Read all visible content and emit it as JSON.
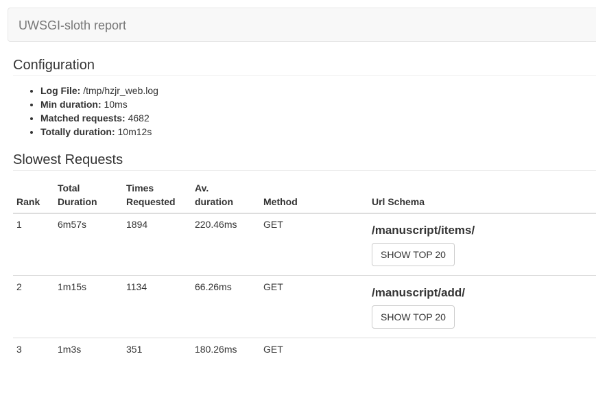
{
  "navbar": {
    "brand": "UWSGI-sloth report"
  },
  "configuration": {
    "heading": "Configuration",
    "items": [
      {
        "label": "Log File:",
        "value": "/tmp/hzjr_web.log"
      },
      {
        "label": "Min duration:",
        "value": "10ms"
      },
      {
        "label": "Matched requests:",
        "value": "4682"
      },
      {
        "label": "Totally duration:",
        "value": "10m12s"
      }
    ]
  },
  "slowest": {
    "heading": "Slowest Requests",
    "columns": {
      "rank": "Rank",
      "total_l1": "Total",
      "total_l2": "Duration",
      "times_l1": "Times",
      "times_l2": "Requested",
      "avg_l1": "Av.",
      "avg_l2": "duration",
      "method": "Method",
      "url": "Url Schema"
    },
    "rows": [
      {
        "rank": "1",
        "total": "6m57s",
        "times": "1894",
        "avg": "220.46ms",
        "method": "GET",
        "url": "/manuscript/items/",
        "button": "SHOW TOP 20"
      },
      {
        "rank": "2",
        "total": "1m15s",
        "times": "1134",
        "avg": "66.26ms",
        "method": "GET",
        "url": "/manuscript/add/",
        "button": "SHOW TOP 20"
      },
      {
        "rank": "3",
        "total": "1m3s",
        "times": "351",
        "avg": "180.26ms",
        "method": "GET",
        "url": "",
        "button": ""
      }
    ]
  }
}
